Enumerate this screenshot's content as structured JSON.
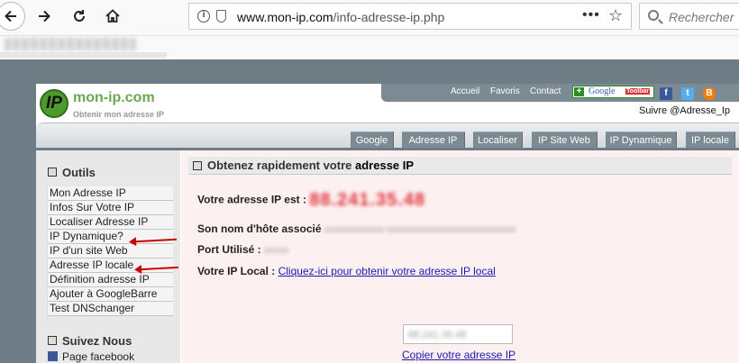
{
  "browser": {
    "url_host": "www.mon-ip.com",
    "url_path": "/info-adresse-ip.php",
    "search_placeholder": "Rechercher",
    "bookmark_label": "Bookmark blurred"
  },
  "site": {
    "logo_mark": "IP",
    "logo_name": "mon-ip.com",
    "logo_tagline": "Obtenir mon adresse IP",
    "top_links": [
      "Accueil",
      "Favoris",
      "Contact"
    ],
    "google_toolbar": {
      "google": "Google",
      "toolbar": "Toolbar"
    },
    "social_icons": [
      "facebook-icon",
      "twitter-icon",
      "blogger-icon"
    ],
    "suivre": "Suivre @Adresse_Ip",
    "tabs": [
      "Google",
      "Adresse IP",
      "Localiser",
      "IP Site Web",
      "IP Dynamique",
      "IP locale"
    ]
  },
  "sidebar": {
    "outils_title": "Outils",
    "items": [
      "Mon Adresse IP",
      "Infos Sur Votre IP",
      "Localiser Adresse IP",
      "IP Dynamique?",
      "IP d'un site Web",
      "Adresse IP locale",
      "Définition adresse IP",
      "Ajouter à GoogleBarre",
      "Test DNSchanger"
    ],
    "suivez_title": "Suivez Nous",
    "facebook_label": "Page facebook",
    "arrow_color": "#cc0000"
  },
  "main": {
    "title_prefix": "Obtenez rapidement votre",
    "title_strong": "adresse IP",
    "ip_label": "Votre adresse IP est :",
    "ip_value_blurred": "88.241.35.48",
    "host_label": "Son nom d'hôte associé",
    "host_value_blurred": "xxxxxxxxxxxx-xxxxxxxxxxxxxxxxxxxxxxxxxx",
    "port_label": "Port Utilisé :",
    "port_value_blurred": "xxxxx",
    "local_label": "Votre IP Local :",
    "local_link": "Cliquez-ici pour obtenir votre adresse IP local",
    "copy_box_blurred": "88.241.35.48",
    "copy_link": "Copier votre adresse IP"
  },
  "colors": {
    "page_bg": "#6e7c85",
    "nav_grey": "#7c8a93",
    "logo_green": "#6aa84f",
    "main_bg": "#fdf0f0",
    "ip_red": "#e0323a",
    "link_blue": "#1a1ab0"
  }
}
